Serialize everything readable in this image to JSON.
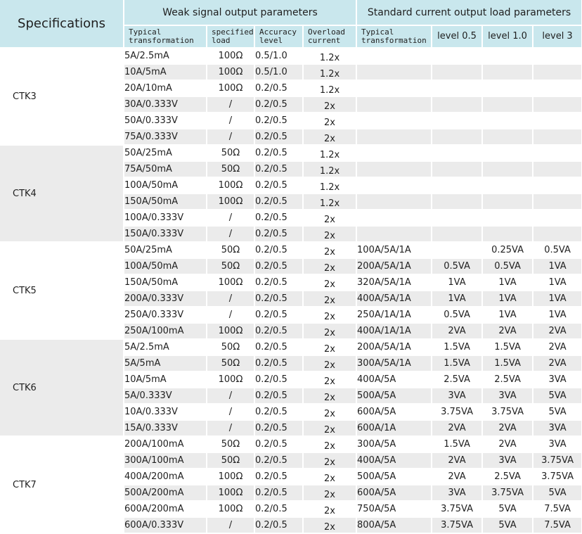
{
  "header": {
    "specifications": "Specifications",
    "weak_group": "Weak signal output parameters",
    "std_group": "Standard current output load parameters",
    "cols": {
      "weak_typical": "Typical\ntransformation",
      "specified_load": "specified\nload",
      "accuracy_level": "Accuracy\nlevel",
      "overload_current": "Overload\ncurrent",
      "std_typical": "Typical\ntransformation",
      "level_05": "level 0.5",
      "level_10": "level 1.0",
      "level_3": "level 3"
    }
  },
  "groups": [
    {
      "name": "CTK3",
      "rows": [
        {
          "weak": "5A/2.5mA",
          "load": "100Ω",
          "acc": "0.5/1.0",
          "ovl": "1.2x",
          "std": "",
          "l05": "",
          "l10": "",
          "l3": ""
        },
        {
          "weak": "10A/5mA",
          "load": "100Ω",
          "acc": "0.5/1.0",
          "ovl": "1.2x",
          "std": "",
          "l05": "",
          "l10": "",
          "l3": ""
        },
        {
          "weak": "20A/10mA",
          "load": "100Ω",
          "acc": "0.2/0.5",
          "ovl": "1.2x",
          "std": "",
          "l05": "",
          "l10": "",
          "l3": ""
        },
        {
          "weak": "30A/0.333V",
          "load": "/",
          "acc": "0.2/0.5",
          "ovl": "2x",
          "std": "",
          "l05": "",
          "l10": "",
          "l3": ""
        },
        {
          "weak": "50A/0.333V",
          "load": "/",
          "acc": "0.2/0.5",
          "ovl": "2x",
          "std": "",
          "l05": "",
          "l10": "",
          "l3": ""
        },
        {
          "weak": "75A/0.333V",
          "load": "/",
          "acc": "0.2/0.5",
          "ovl": "2x",
          "std": "",
          "l05": "",
          "l10": "",
          "l3": ""
        }
      ]
    },
    {
      "name": "CTK4",
      "rows": [
        {
          "weak": "50A/25mA",
          "load": "50Ω",
          "acc": "0.2/0.5",
          "ovl": "1.2x",
          "std": "",
          "l05": "",
          "l10": "",
          "l3": ""
        },
        {
          "weak": "75A/50mA",
          "load": "50Ω",
          "acc": "0.2/0.5",
          "ovl": "1.2x",
          "std": "",
          "l05": "",
          "l10": "",
          "l3": ""
        },
        {
          "weak": "100A/50mA",
          "load": "100Ω",
          "acc": "0.2/0.5",
          "ovl": "1.2x",
          "std": "",
          "l05": "",
          "l10": "",
          "l3": ""
        },
        {
          "weak": "150A/50mA",
          "load": "100Ω",
          "acc": "0.2/0.5",
          "ovl": "1.2x",
          "std": "",
          "l05": "",
          "l10": "",
          "l3": ""
        },
        {
          "weak": "100A/0.333V",
          "load": "/",
          "acc": "0.2/0.5",
          "ovl": "2x",
          "std": "",
          "l05": "",
          "l10": "",
          "l3": ""
        },
        {
          "weak": "150A/0.333V",
          "load": "/",
          "acc": "0.2/0.5",
          "ovl": "2x",
          "std": "",
          "l05": "",
          "l10": "",
          "l3": ""
        }
      ]
    },
    {
      "name": "CTK5",
      "rows": [
        {
          "weak": "50A/25mA",
          "load": "50Ω",
          "acc": "0.2/0.5",
          "ovl": "2x",
          "std": "100A/5A/1A",
          "l05": "",
          "l10": "0.25VA",
          "l3": "0.5VA"
        },
        {
          "weak": "100A/50mA",
          "load": "50Ω",
          "acc": "0.2/0.5",
          "ovl": "2x",
          "std": "200A/5A/1A",
          "l05": "0.5VA",
          "l10": "0.5VA",
          "l3": "1VA"
        },
        {
          "weak": "150A/50mA",
          "load": "100Ω",
          "acc": "0.2/0.5",
          "ovl": "2x",
          "std": "320A/5A/1A",
          "l05": "1VA",
          "l10": "1VA",
          "l3": "1VA"
        },
        {
          "weak": "200A/0.333V",
          "load": "/",
          "acc": "0.2/0.5",
          "ovl": "2x",
          "std": "400A/5A/1A",
          "l05": "1VA",
          "l10": "1VA",
          "l3": "1VA"
        },
        {
          "weak": "250A/0.333V",
          "load": "/",
          "acc": "0.2/0.5",
          "ovl": "2x",
          "std": "250A/1A/1A",
          "l05": "0.5VA",
          "l10": "1VA",
          "l3": "1VA"
        },
        {
          "weak": "250A/100mA",
          "load": "100Ω",
          "acc": "0.2/0.5",
          "ovl": "2x",
          "std": "400A/1A/1A",
          "l05": "2VA",
          "l10": "2VA",
          "l3": "2VA"
        }
      ]
    },
    {
      "name": "CTK6",
      "rows": [
        {
          "weak": "5A/2.5mA",
          "load": "50Ω",
          "acc": "0.2/0.5",
          "ovl": "2x",
          "std": "200A/5A/1A",
          "l05": "1.5VA",
          "l10": "1.5VA",
          "l3": "2VA"
        },
        {
          "weak": "5A/5mA",
          "load": "50Ω",
          "acc": "0.2/0.5",
          "ovl": "2x",
          "std": "300A/5A/1A",
          "l05": "1.5VA",
          "l10": "1.5VA",
          "l3": "2VA"
        },
        {
          "weak": "10A/5mA",
          "load": "100Ω",
          "acc": "0.2/0.5",
          "ovl": "2x",
          "std": "400A/5A",
          "l05": "2.5VA",
          "l10": "2.5VA",
          "l3": "3VA"
        },
        {
          "weak": "5A/0.333V",
          "load": "/",
          "acc": "0.2/0.5",
          "ovl": "2x",
          "std": "500A/5A",
          "l05": "3VA",
          "l10": "3VA",
          "l3": "5VA"
        },
        {
          "weak": "10A/0.333V",
          "load": "/",
          "acc": "0.2/0.5",
          "ovl": "2x",
          "std": "600A/5A",
          "l05": "3.75VA",
          "l10": "3.75VA",
          "l3": "5VA"
        },
        {
          "weak": "15A/0.333V",
          "load": "/",
          "acc": "0.2/0.5",
          "ovl": "2x",
          "std": "600A/1A",
          "l05": "2VA",
          "l10": "2VA",
          "l3": "3VA"
        }
      ]
    },
    {
      "name": "CTK7",
      "rows": [
        {
          "weak": "200A/100mA",
          "load": "50Ω",
          "acc": "0.2/0.5",
          "ovl": "2x",
          "std": "300A/5A",
          "l05": "1.5VA",
          "l10": "2VA",
          "l3": "3VA"
        },
        {
          "weak": "300A/100mA",
          "load": "50Ω",
          "acc": "0.2/0.5",
          "ovl": "2x",
          "std": "400A/5A",
          "l05": "2VA",
          "l10": "3VA",
          "l3": "3.75VA"
        },
        {
          "weak": "400A/200mA",
          "load": "100Ω",
          "acc": "0.2/0.5",
          "ovl": "2x",
          "std": "500A/5A",
          "l05": "2VA",
          "l10": "2.5VA",
          "l3": "3.75VA"
        },
        {
          "weak": "500A/200mA",
          "load": "100Ω",
          "acc": "0.2/0.5",
          "ovl": "2x",
          "std": "600A/5A",
          "l05": "3VA",
          "l10": "3.75VA",
          "l3": "5VA"
        },
        {
          "weak": "600A/200mA",
          "load": "100Ω",
          "acc": "0.2/0.5",
          "ovl": "2x",
          "std": "750A/5A",
          "l05": "3.75VA",
          "l10": "5VA",
          "l3": "7.5VA"
        },
        {
          "weak": "600A/0.333V",
          "load": "/",
          "acc": "0.2/0.5",
          "ovl": "2x",
          "std": "800A/5A",
          "l05": "3.75VA",
          "l10": "5VA",
          "l3": "7.5VA"
        }
      ]
    }
  ]
}
